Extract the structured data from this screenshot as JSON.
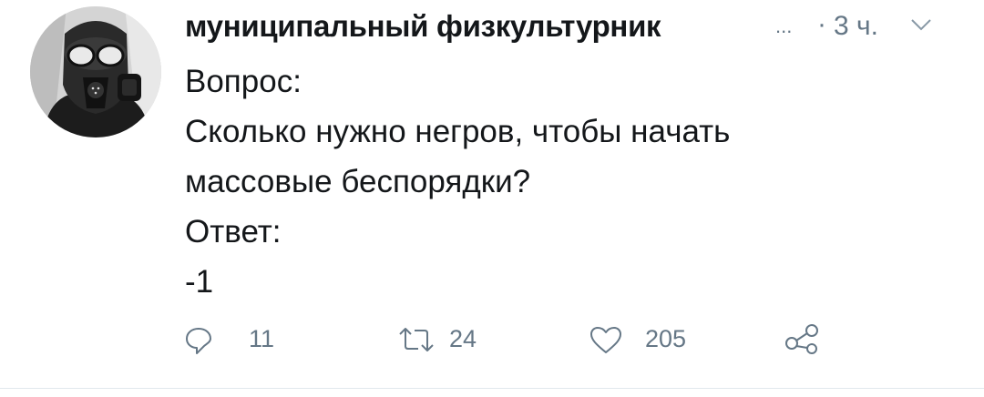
{
  "tweet": {
    "author_name": "муниципальный физкультурник",
    "truncation": "...",
    "separator": "·",
    "time": "3 ч.",
    "lines": [
      "Вопрос:",
      "Сколько нужно негров, чтобы начать",
      "массовые беспорядки?",
      "Ответ:",
      "-1"
    ]
  },
  "actions": {
    "replies": "11",
    "retweets": "24",
    "likes": "205"
  },
  "icons": {
    "avatar": "gas-mask-avatar",
    "menu": "chevron-down-icon",
    "reply": "reply-icon",
    "retweet": "retweet-icon",
    "like": "heart-icon",
    "share": "share-icon"
  },
  "colors": {
    "text": "#14171a",
    "secondary": "#657786",
    "divider": "#e1e8ed"
  }
}
